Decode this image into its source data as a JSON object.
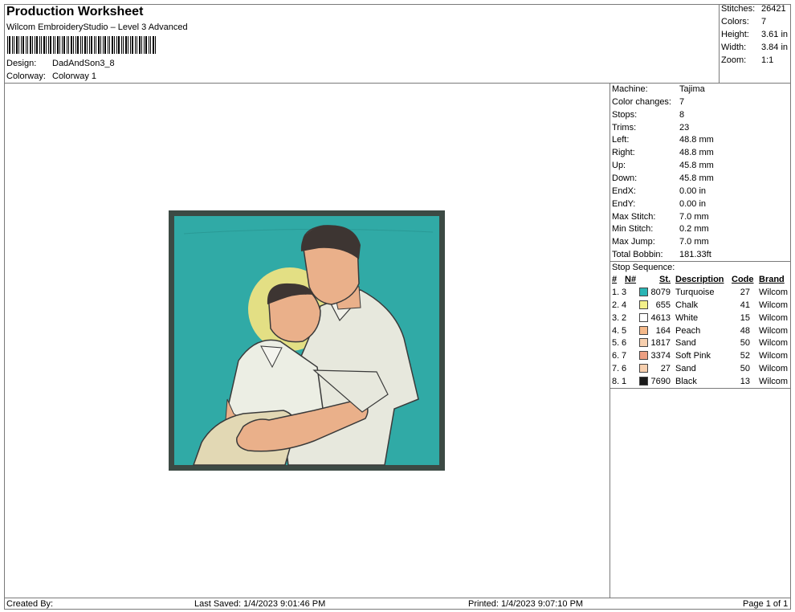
{
  "header": {
    "title": "Production Worksheet",
    "software": "Wilcom EmbroideryStudio – Level 3 Advanced",
    "design_label": "Design:",
    "design_value": "DadAndSon3_8",
    "colorway_label": "Colorway:",
    "colorway_value": "Colorway 1"
  },
  "summary": [
    {
      "label": "Stitches:",
      "value": "26421"
    },
    {
      "label": "Colors:",
      "value": "7"
    },
    {
      "label": "Height:",
      "value": "3.61 in"
    },
    {
      "label": "Width:",
      "value": "3.84 in"
    },
    {
      "label": "Zoom:",
      "value": "1:1"
    }
  ],
  "machine_info": [
    {
      "label": "Machine:",
      "value": "Tajima"
    },
    {
      "label": "Color changes:",
      "value": "7"
    },
    {
      "label": "Stops:",
      "value": "8"
    },
    {
      "label": "Trims:",
      "value": "23"
    },
    {
      "label": "Left:",
      "value": "48.8 mm"
    },
    {
      "label": "Right:",
      "value": "48.8 mm"
    },
    {
      "label": "Up:",
      "value": "45.8 mm"
    },
    {
      "label": "Down:",
      "value": "45.8 mm"
    },
    {
      "label": "EndX:",
      "value": "0.00 in"
    },
    {
      "label": "EndY:",
      "value": "0.00 in"
    },
    {
      "label": "Max Stitch:",
      "value": "7.0 mm"
    },
    {
      "label": "Min Stitch:",
      "value": "0.2 mm"
    },
    {
      "label": "Max Jump:",
      "value": "7.0 mm"
    },
    {
      "label": "Total Bobbin:",
      "value": "181.33ft"
    }
  ],
  "stop_sequence": {
    "title": "Stop Sequence:",
    "headers": {
      "num": "#",
      "n": "N#",
      "st": "St.",
      "desc": "Description",
      "code": "Code",
      "brand": "Brand"
    },
    "rows": [
      {
        "num": "1.",
        "n": "3",
        "color": "#2ab5b5",
        "st": "8079",
        "desc": "Turquoise",
        "code": "27",
        "brand": "Wilcom"
      },
      {
        "num": "2.",
        "n": "4",
        "color": "#f3f08a",
        "st": "655",
        "desc": "Chalk",
        "code": "41",
        "brand": "Wilcom"
      },
      {
        "num": "3.",
        "n": "2",
        "color": "#ffffff",
        "st": "4613",
        "desc": "White",
        "code": "15",
        "brand": "Wilcom"
      },
      {
        "num": "4.",
        "n": "5",
        "color": "#f5b98a",
        "st": "164",
        "desc": "Peach",
        "code": "48",
        "brand": "Wilcom"
      },
      {
        "num": "5.",
        "n": "6",
        "color": "#f7cfae",
        "st": "1817",
        "desc": "Sand",
        "code": "50",
        "brand": "Wilcom"
      },
      {
        "num": "6.",
        "n": "7",
        "color": "#ec9f82",
        "st": "3374",
        "desc": "Soft Pink",
        "code": "52",
        "brand": "Wilcom"
      },
      {
        "num": "7.",
        "n": "6",
        "color": "#f7cfae",
        "st": "27",
        "desc": "Sand",
        "code": "50",
        "brand": "Wilcom"
      },
      {
        "num": "8.",
        "n": "1",
        "color": "#1a1a1a",
        "st": "7690",
        "desc": "Black",
        "code": "13",
        "brand": "Wilcom"
      }
    ]
  },
  "footer": {
    "created_by": "Created By:",
    "last_saved": "Last Saved: 1/4/2023 9:01:46 PM",
    "printed": "Printed: 1/4/2023 9:07:10 PM",
    "page": "Page 1 of 1"
  }
}
